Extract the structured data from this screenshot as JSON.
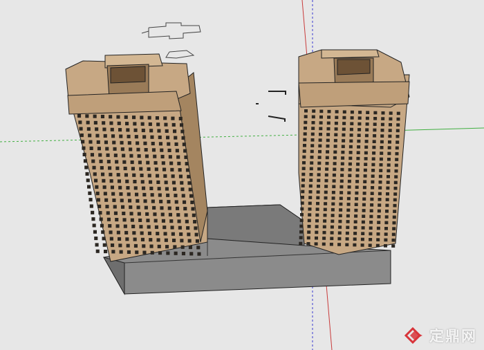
{
  "viewport": {
    "background": "#e7e7e7",
    "axes": {
      "red": "#c83a3a",
      "green": "#3fae3f",
      "blue": "#3a3ad0"
    },
    "building_color": "#c7a884",
    "building_shade": "#a48560",
    "window_color": "#2b2722",
    "base_color": "#8b8b8b"
  },
  "watermark": {
    "text": "定鼎网",
    "color": "#d8343a"
  }
}
